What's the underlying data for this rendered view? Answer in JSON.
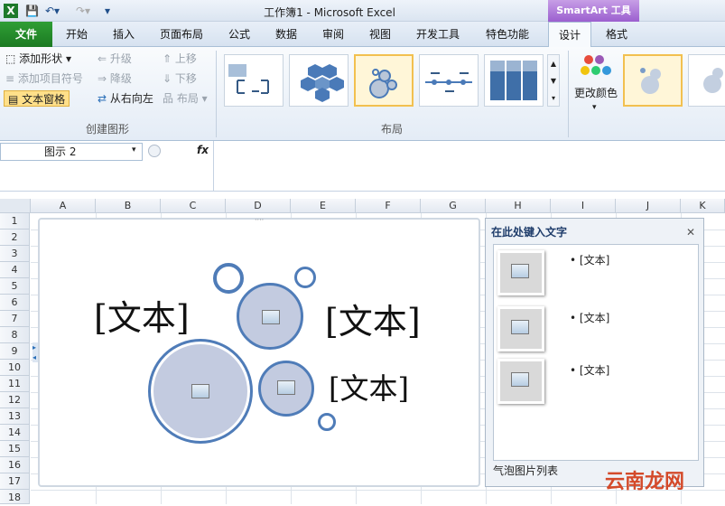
{
  "window": {
    "title": "工作簿1 - Microsoft Excel"
  },
  "context_tab_group": "SmartArt 工具",
  "tabs": [
    "文件",
    "开始",
    "插入",
    "页面布局",
    "公式",
    "数据",
    "审阅",
    "视图",
    "开发工具",
    "特色功能",
    "设计",
    "格式"
  ],
  "ribbon": {
    "create_graphic": {
      "label": "创建图形",
      "add_shape": "添加形状",
      "add_bullet": "添加项目符号",
      "text_pane": "文本窗格",
      "promote": "升级",
      "demote": "降级",
      "right_to_left": "从右向左",
      "move_up": "上移",
      "move_down": "下移",
      "layout": "布局"
    },
    "layouts": {
      "label": "布局"
    },
    "change_colors": "更改颜色"
  },
  "formula_bar": {
    "name_box": "图示 2",
    "fx": "fx"
  },
  "columns": [
    "A",
    "B",
    "C",
    "D",
    "E",
    "F",
    "G",
    "H",
    "I",
    "J",
    "K"
  ],
  "rows": [
    "1",
    "2",
    "3",
    "4",
    "5",
    "6",
    "7",
    "8",
    "9",
    "10",
    "11",
    "12",
    "13",
    "14",
    "15",
    "16",
    "17",
    "18"
  ],
  "smartart": {
    "placeholders": [
      "[文本]",
      "[文本]",
      "[文本]"
    ]
  },
  "text_pane": {
    "title": "在此处键入文字",
    "close": "✕",
    "bullets": [
      "[文本]",
      "[文本]",
      "[文本]"
    ],
    "footer": "气泡图片列表"
  },
  "watermark": "云南龙网"
}
